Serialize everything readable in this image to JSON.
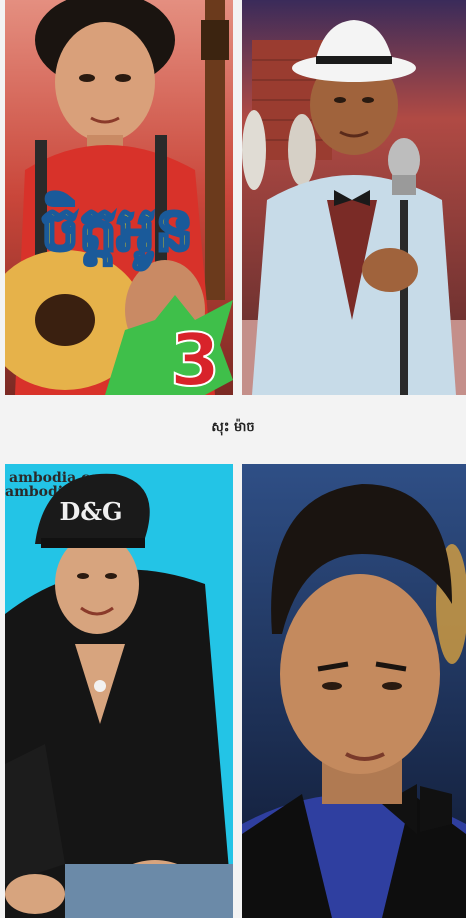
{
  "caption": "សុះ ម៉ាច",
  "photos": [
    {
      "overlay_text_main": "ចិត្តអូន",
      "overlay_number": "3",
      "colors": {
        "background": "#c9463a",
        "title_fill": "#f2d20e",
        "title_stroke": "#1a5a9a",
        "burst": "#3fbf4a",
        "number": "#d8232a"
      }
    },
    {
      "colors": {
        "background": "#7d2a2a",
        "jacket": "#c7dbe8",
        "shirt": "#7a2b26",
        "hat": "#f4f4f4"
      }
    },
    {
      "watermark_1": "ambodia.com",
      "watermark_2": "ambodia.com",
      "cap_text": "D&G",
      "colors": {
        "background": "#23c4e6",
        "cap": "#1a1a1a",
        "jacket": "#151515"
      }
    },
    {
      "colors": {
        "background": "#1b2b52",
        "shirt": "#2f3fa0",
        "bowtie": "#111111"
      }
    }
  ]
}
